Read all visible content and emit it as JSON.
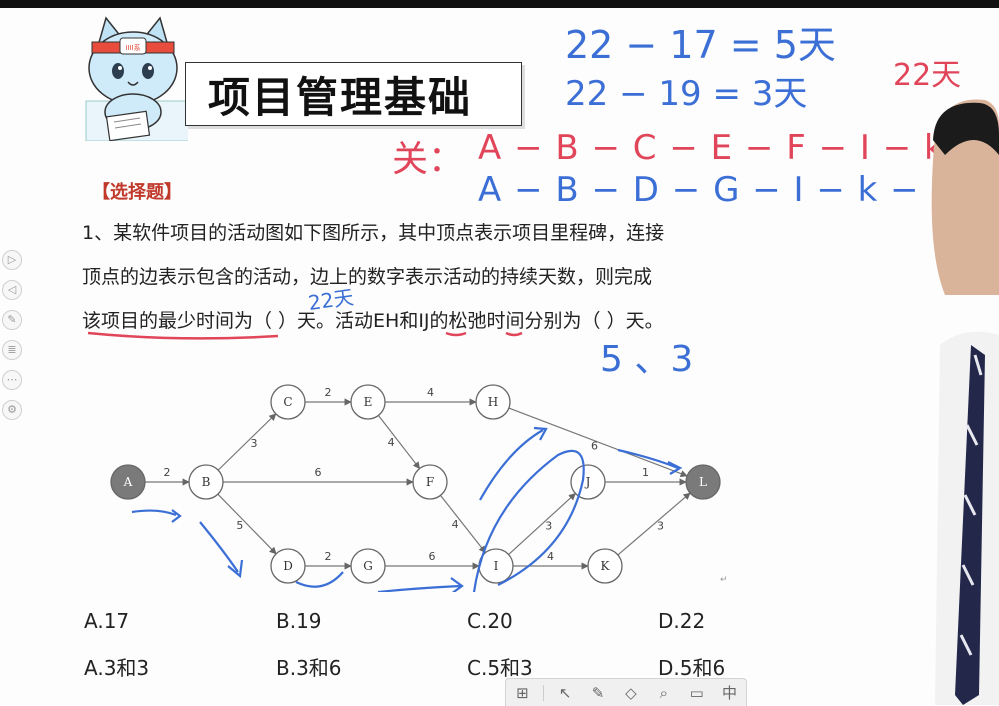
{
  "header": {
    "title": "项目管理基础",
    "cat_badge": "IIII系"
  },
  "question": {
    "tag": "【选择题】",
    "lines": [
      "1、某软件项目的活动图如下图所示，其中顶点表示项目里程碑，连接",
      "顶点的边表示包含的活动，边上的数字表示活动的持续天数，则完成",
      "该项目的最少时间为（ ）天。活动EH和IJ的松弛时间分别为（ ）天。"
    ]
  },
  "graph": {
    "nodes": [
      {
        "id": "A",
        "filled": true
      },
      {
        "id": "B",
        "filled": false
      },
      {
        "id": "C",
        "filled": false
      },
      {
        "id": "D",
        "filled": false
      },
      {
        "id": "E",
        "filled": false
      },
      {
        "id": "F",
        "filled": false
      },
      {
        "id": "G",
        "filled": false
      },
      {
        "id": "H",
        "filled": false
      },
      {
        "id": "I",
        "filled": false
      },
      {
        "id": "J",
        "filled": false
      },
      {
        "id": "K",
        "filled": false
      },
      {
        "id": "L",
        "filled": true
      }
    ],
    "edges": [
      {
        "from": "A",
        "to": "B",
        "weight": "2"
      },
      {
        "from": "B",
        "to": "C",
        "weight": "3"
      },
      {
        "from": "B",
        "to": "F",
        "weight": "6"
      },
      {
        "from": "B",
        "to": "D",
        "weight": "5"
      },
      {
        "from": "C",
        "to": "E",
        "weight": "2"
      },
      {
        "from": "E",
        "to": "H",
        "weight": "4"
      },
      {
        "from": "E",
        "to": "F",
        "weight": "4"
      },
      {
        "from": "D",
        "to": "G",
        "weight": "2"
      },
      {
        "from": "G",
        "to": "I",
        "weight": "6"
      },
      {
        "from": "F",
        "to": "I",
        "weight": "4"
      },
      {
        "from": "H",
        "to": "L",
        "weight": "6"
      },
      {
        "from": "I",
        "to": "J",
        "weight": "3"
      },
      {
        "from": "I",
        "to": "K",
        "weight": "4"
      },
      {
        "from": "J",
        "to": "L",
        "weight": "1"
      },
      {
        "from": "K",
        "to": "L",
        "weight": "3"
      }
    ]
  },
  "options": {
    "row1": [
      "A.17",
      "B.19",
      "C.20",
      "D.22"
    ],
    "row2": [
      "A.3和3",
      "B.3和6",
      "C.5和3",
      "D.5和6"
    ]
  },
  "annotations": {
    "eq1": "22 − 17 = 5天",
    "eq2": "22 − 19 = 3天",
    "total_red": "22天",
    "path_label": "关：",
    "path1": "A − B − C − E − F − I − k − L",
    "path2": "A − B − D − G − I − k − L",
    "answer1": "22天",
    "answer2": "5 、3"
  },
  "toolbar": {
    "icons": [
      "grid-icon",
      "pointer-icon",
      "pen-icon",
      "eraser-icon",
      "zoom-icon",
      "screen-icon",
      "cn-icon"
    ],
    "cn_label": "中"
  },
  "colors": {
    "blue_ink": "#3b6fd6",
    "red_ink": "#e0455a",
    "node_fill": "#7a7a7a"
  }
}
